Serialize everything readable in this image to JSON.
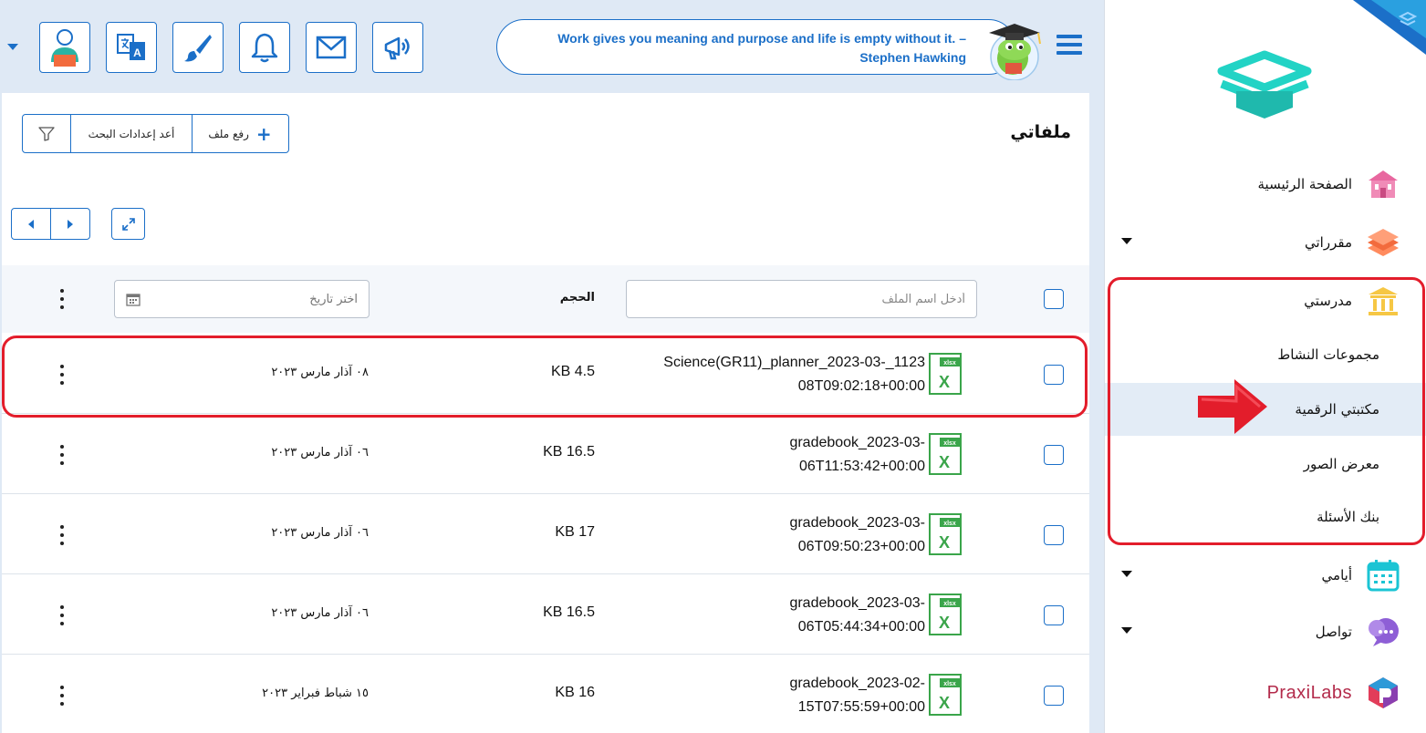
{
  "sidebar": {
    "items": [
      {
        "label": "الصفحة الرئيسية",
        "icon": "school-building-icon"
      },
      {
        "label": "مقرراتي",
        "icon": "books-icon"
      },
      {
        "label": "مدرستي",
        "icon": "institution-icon"
      },
      {
        "label": "أيامي",
        "icon": "calendar-icon"
      },
      {
        "label": "تواصل",
        "icon": "chat-bubbles-icon"
      }
    ],
    "sub_items": [
      {
        "label": "مجموعات النشاط"
      },
      {
        "label": "مكتبتي الرقمية",
        "active": true
      },
      {
        "label": "معرض الصور"
      },
      {
        "label": "بنك الأسئلة"
      }
    ],
    "partner": "PraxiLabs"
  },
  "header": {
    "quote": "Work gives you meaning and purpose and life is empty without it. –",
    "quote_author": "Stephen Hawking",
    "buttons": [
      "announcement-icon",
      "mail-icon",
      "bell-icon",
      "paint-brush-icon",
      "translate-icon",
      "user-profile-icon"
    ]
  },
  "main": {
    "title": "ملفاتي",
    "toolbar": {
      "upload_label": "رفع ملف",
      "reset_label": "أعد إعدادات البحث"
    },
    "table": {
      "name_placeholder": "أدخل اسم الملف",
      "size_header": "الحجم",
      "date_placeholder": "اختر تاريخ",
      "rows": [
        {
          "name_line1": "Science(GR11)_planner_2023-03-_1123",
          "name_line2": "08T09:02:18+00:00",
          "size": "KB 4.5",
          "date": "٠٨ آذار مارس ٢٠٢٣"
        },
        {
          "name_line1": "gradebook_2023-03-",
          "name_line2": "06T11:53:42+00:00",
          "size": "KB 16.5",
          "date": "٠٦ آذار مارس ٢٠٢٣"
        },
        {
          "name_line1": "gradebook_2023-03-",
          "name_line2": "06T09:50:23+00:00",
          "size": "KB 17",
          "date": "٠٦ آذار مارس ٢٠٢٣"
        },
        {
          "name_line1": "gradebook_2023-03-",
          "name_line2": "06T05:44:34+00:00",
          "size": "KB 16.5",
          "date": "٠٦ آذار مارس ٢٠٢٣"
        },
        {
          "name_line1": "gradebook_2023-02-",
          "name_line2": "15T07:55:59+00:00",
          "size": "KB 16",
          "date": "١٥ شباط فبراير ٢٠٢٣"
        }
      ]
    }
  },
  "colors": {
    "accent": "#1b6fc8",
    "highlight": "#e31d2b",
    "excel": "#3aa54a"
  }
}
